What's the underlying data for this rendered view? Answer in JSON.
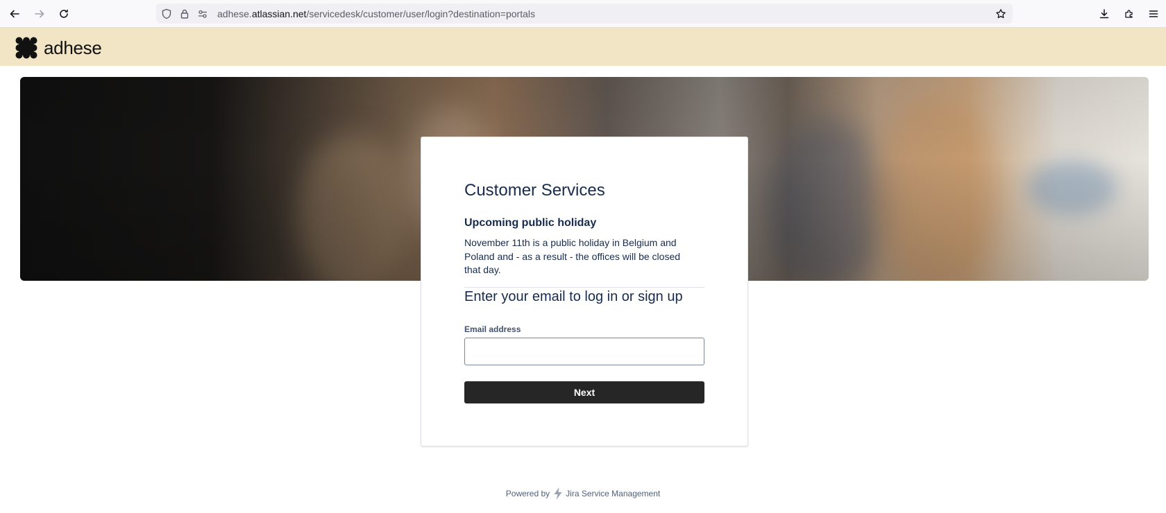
{
  "browser": {
    "url_prefix": "adhese.",
    "url_domain": "atlassian.net",
    "url_path": "/servicedesk/customer/user/login?destination=portals",
    "icons": [
      "back-icon",
      "forward-icon",
      "reload-icon",
      "shield-icon",
      "lock-icon",
      "permissions-icon",
      "bookmark-star-icon",
      "download-icon",
      "extensions-icon",
      "menu-icon"
    ]
  },
  "header": {
    "logo_text": "adhese",
    "background_color": "#f1e5c6"
  },
  "card": {
    "title": "Customer Services",
    "notice_title": "Upcoming public holiday",
    "notice_body": "November 11th is a public holiday in Belgium and Poland and - as a result - the offices will be closed that day.",
    "login_title": "Enter your email to log in or sign up",
    "email_label": "Email address",
    "email_value": "",
    "next_label": "Next"
  },
  "footer": {
    "powered_by": "Powered by",
    "product": "Jira Service Management"
  },
  "colors": {
    "button": "#262626",
    "heading": "#172b4d"
  }
}
